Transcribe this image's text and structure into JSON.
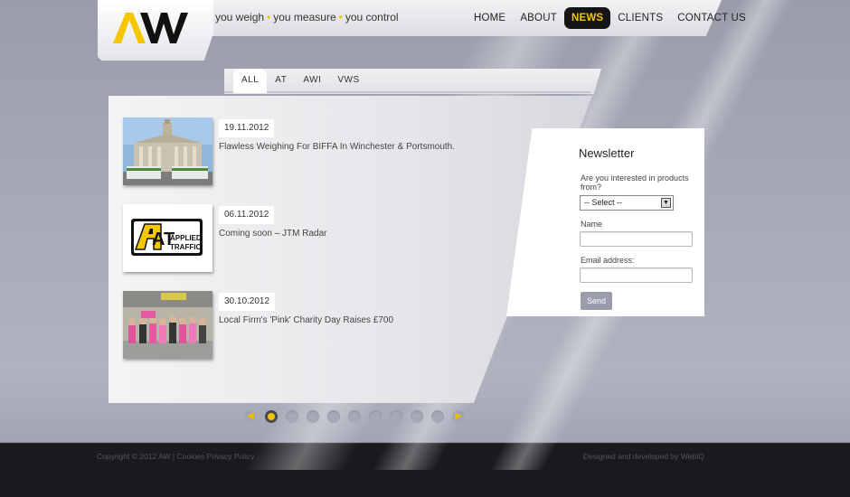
{
  "brand": {
    "logo_text": "AW",
    "accent": "#f3c600"
  },
  "tagline": [
    "you weigh",
    "you measure",
    "you control"
  ],
  "nav": [
    {
      "label": "HOME"
    },
    {
      "label": "ABOUT"
    },
    {
      "label": "NEWS",
      "active": true
    },
    {
      "label": "CLIENTS"
    },
    {
      "label": "CONTACT US"
    }
  ],
  "tabs": [
    {
      "label": "ALL",
      "active": true
    },
    {
      "label": "AT"
    },
    {
      "label": "AWI"
    },
    {
      "label": "VWS"
    }
  ],
  "news": [
    {
      "date": "19.11.2012",
      "title": "Flawless Weighing For BIFFA In Winchester & Portsmouth.",
      "image": "town-hall-trucks-photo"
    },
    {
      "date": "06.11.2012",
      "title": "Coming soon – JTM Radar",
      "image": "applied-traffic-logo",
      "logo_lines": [
        "APPLIED",
        "TRAFFIC"
      ],
      "logo_mark": "AT"
    },
    {
      "date": "30.10.2012",
      "title": "Local Firm's 'Pink' Charity Day Raises £700",
      "image": "pink-charity-group-photo"
    }
  ],
  "newsletter": {
    "title": "Newsletter",
    "question": "Are you interested in products from?",
    "select_value": "-- Select --",
    "name_label": "Name",
    "email_label": "Email address:",
    "send_label": "Send"
  },
  "pager": {
    "pages": 10,
    "current": 1
  },
  "footer": {
    "copyright": "Copyright © 2012 AW | Cookies Privacy Policy",
    "credit": "Designed and developed by WebIQ"
  }
}
